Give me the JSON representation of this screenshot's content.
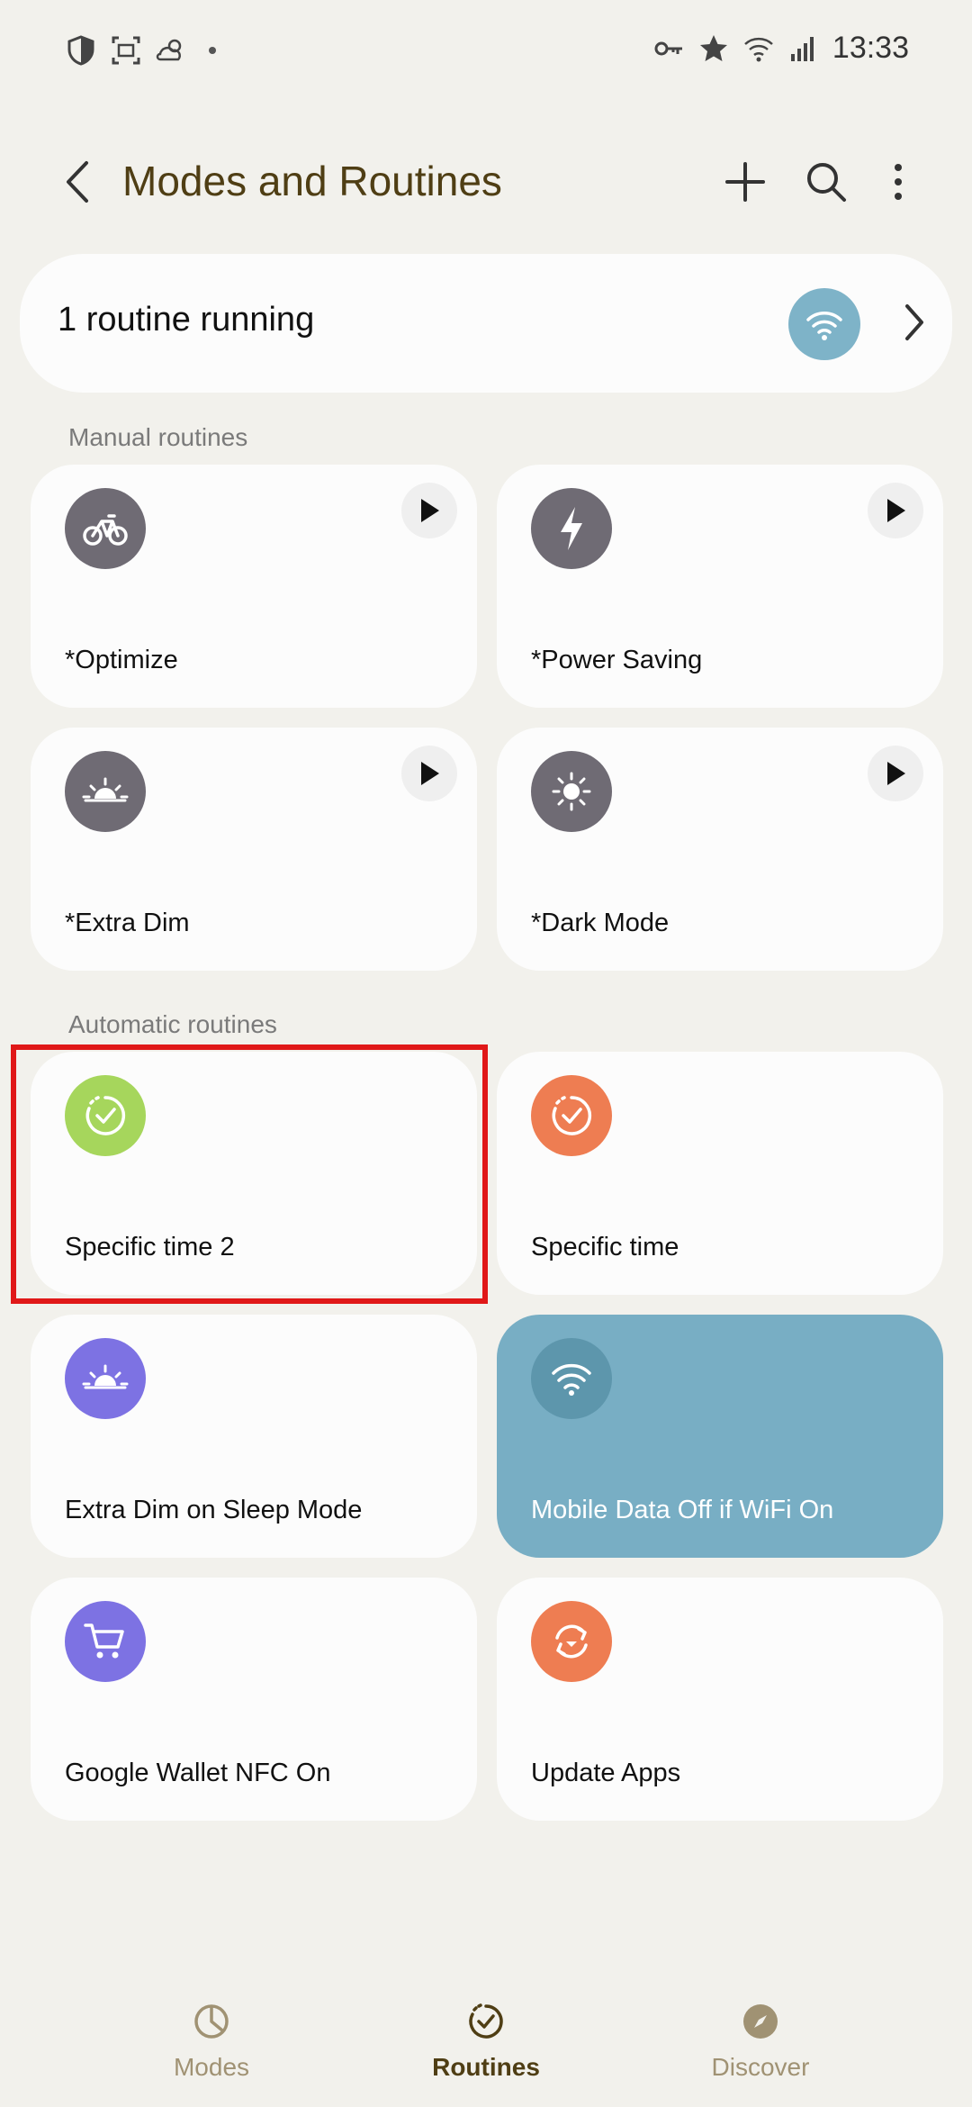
{
  "status_bar": {
    "time": "13:33",
    "left_icons": [
      "shield-icon",
      "screenshot-icon",
      "weather-icon",
      "notification-dot-icon"
    ],
    "right_icons": [
      "vpn-key-icon",
      "star-icon",
      "wifi-icon",
      "signal-icon"
    ]
  },
  "header": {
    "title": "Modes and Routines"
  },
  "running": {
    "text": "1 routine running"
  },
  "sections": {
    "manual": "Manual routines",
    "automatic": "Automatic routines"
  },
  "manual_routines": [
    {
      "label": "*Optimize",
      "icon": "bike-icon",
      "color": "#6f6b74"
    },
    {
      "label": "*Power Saving",
      "icon": "lightning-icon",
      "color": "#6f6b74"
    },
    {
      "label": "*Extra Dim",
      "icon": "sunset-icon",
      "color": "#6f6b74"
    },
    {
      "label": "*Dark Mode",
      "icon": "sun-icon",
      "color": "#6f6b74"
    }
  ],
  "automatic_routines": [
    {
      "label": "Specific time 2",
      "icon": "clock-check-icon",
      "color": "#a6d65c"
    },
    {
      "label": "Specific time",
      "icon": "clock-check-icon",
      "color": "#ee7d52"
    },
    {
      "label": "Extra Dim on Sleep Mode",
      "icon": "sunset-icon",
      "color": "#7d72e3"
    },
    {
      "label": "Mobile Data Off if WiFi On",
      "icon": "wifi-icon",
      "color": "#5d96ac",
      "active": true
    },
    {
      "label": "Google Wallet NFC On",
      "icon": "cart-icon",
      "color": "#7d72e3"
    },
    {
      "label": "Update Apps",
      "icon": "refresh-icon",
      "color": "#ee7d52"
    }
  ],
  "bottom_nav": {
    "modes": "Modes",
    "routines": "Routines",
    "discover": "Discover"
  },
  "colors": {
    "accent": "#4f3e14",
    "background": "#f2f1ec",
    "active_tile": "#78aec4",
    "highlight": "#e01818"
  }
}
